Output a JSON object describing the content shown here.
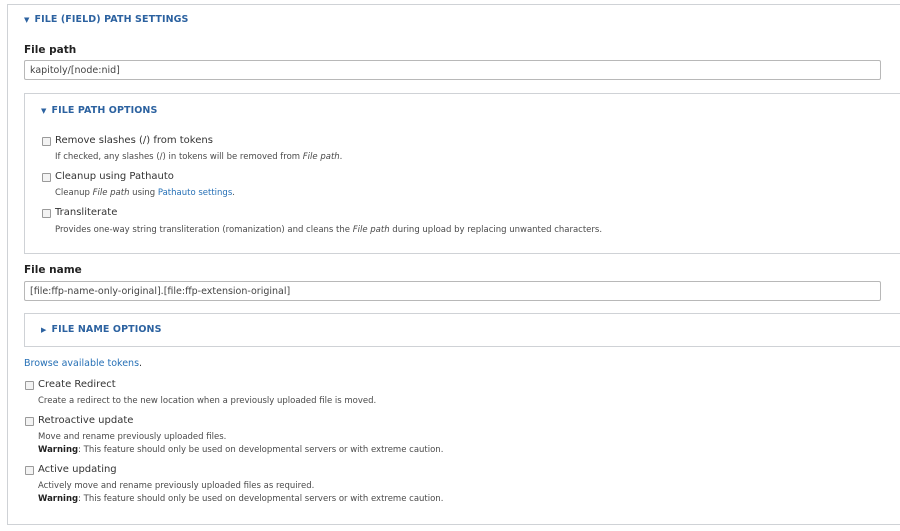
{
  "main_fieldset": {
    "legend": "FILE (FIELD) PATH SETTINGS"
  },
  "file_path": {
    "label": "File path",
    "value": "kapitoly/[node:nid]"
  },
  "file_path_options": {
    "legend": "FILE PATH OPTIONS",
    "remove_slashes": {
      "label": "Remove slashes (/) from tokens",
      "desc_before": "If checked, any slashes (/) in tokens will be removed from ",
      "desc_em": "File path",
      "desc_after": "."
    },
    "pathauto": {
      "label": "Cleanup using Pathauto",
      "desc_before": "Cleanup ",
      "desc_em": "File path",
      "desc_mid": " using ",
      "desc_link": "Pathauto settings",
      "desc_after": "."
    },
    "transliterate": {
      "label": "Transliterate",
      "desc_before": "Provides one-way string transliteration (romanization) and cleans the ",
      "desc_em": "File path",
      "desc_after": " during upload by replacing unwanted characters."
    }
  },
  "file_name": {
    "label": "File name",
    "value": "[file:ffp-name-only-original].[file:ffp-extension-original]"
  },
  "file_name_options": {
    "legend": "FILE NAME OPTIONS"
  },
  "browse_tokens": {
    "link": "Browse available tokens",
    "after": "."
  },
  "create_redirect": {
    "label": "Create Redirect",
    "desc": "Create a redirect to the new location when a previously uploaded file is moved."
  },
  "retroactive_update": {
    "label": "Retroactive update",
    "desc": "Move and rename previously uploaded files.",
    "warning_label": "Warning",
    "warning_text": ": This feature should only be used on developmental servers or with extreme caution."
  },
  "active_updating": {
    "label": "Active updating",
    "desc": "Actively move and rename previously uploaded files as required.",
    "warning_label": "Warning",
    "warning_text": ": This feature should only be used on developmental servers or with extreme caution."
  }
}
